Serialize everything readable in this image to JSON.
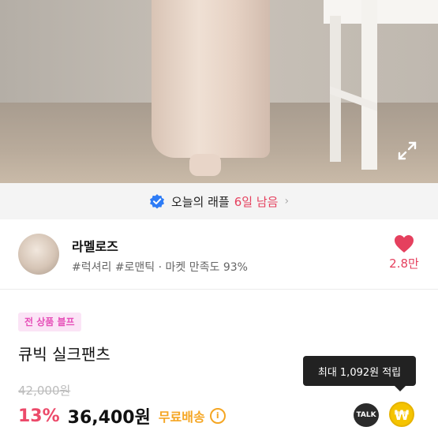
{
  "banner": {
    "text": "오늘의 래플",
    "days": "6일 남음",
    "chevron": "›"
  },
  "shop": {
    "name": "라멜로즈",
    "tags": "#럭셔리 #로맨틱 · 마켓 만족도 93%",
    "likes": "2.8만"
  },
  "product": {
    "badge": "전 상품 블프",
    "title": "큐빅 실크팬츠",
    "original_price": "42,000원",
    "discount": "13%",
    "price": "36,400원",
    "shipping": "무료배송",
    "info_symbol": "i"
  },
  "tooltip": {
    "text": "최대 1,092원 적립"
  },
  "actions": {
    "talk_label": "TALK",
    "won_symbol": "₩"
  },
  "colors": {
    "accent_red": "#e5405e",
    "shipping_orange": "#f5a623",
    "badge_pink": "#e64fb8"
  }
}
